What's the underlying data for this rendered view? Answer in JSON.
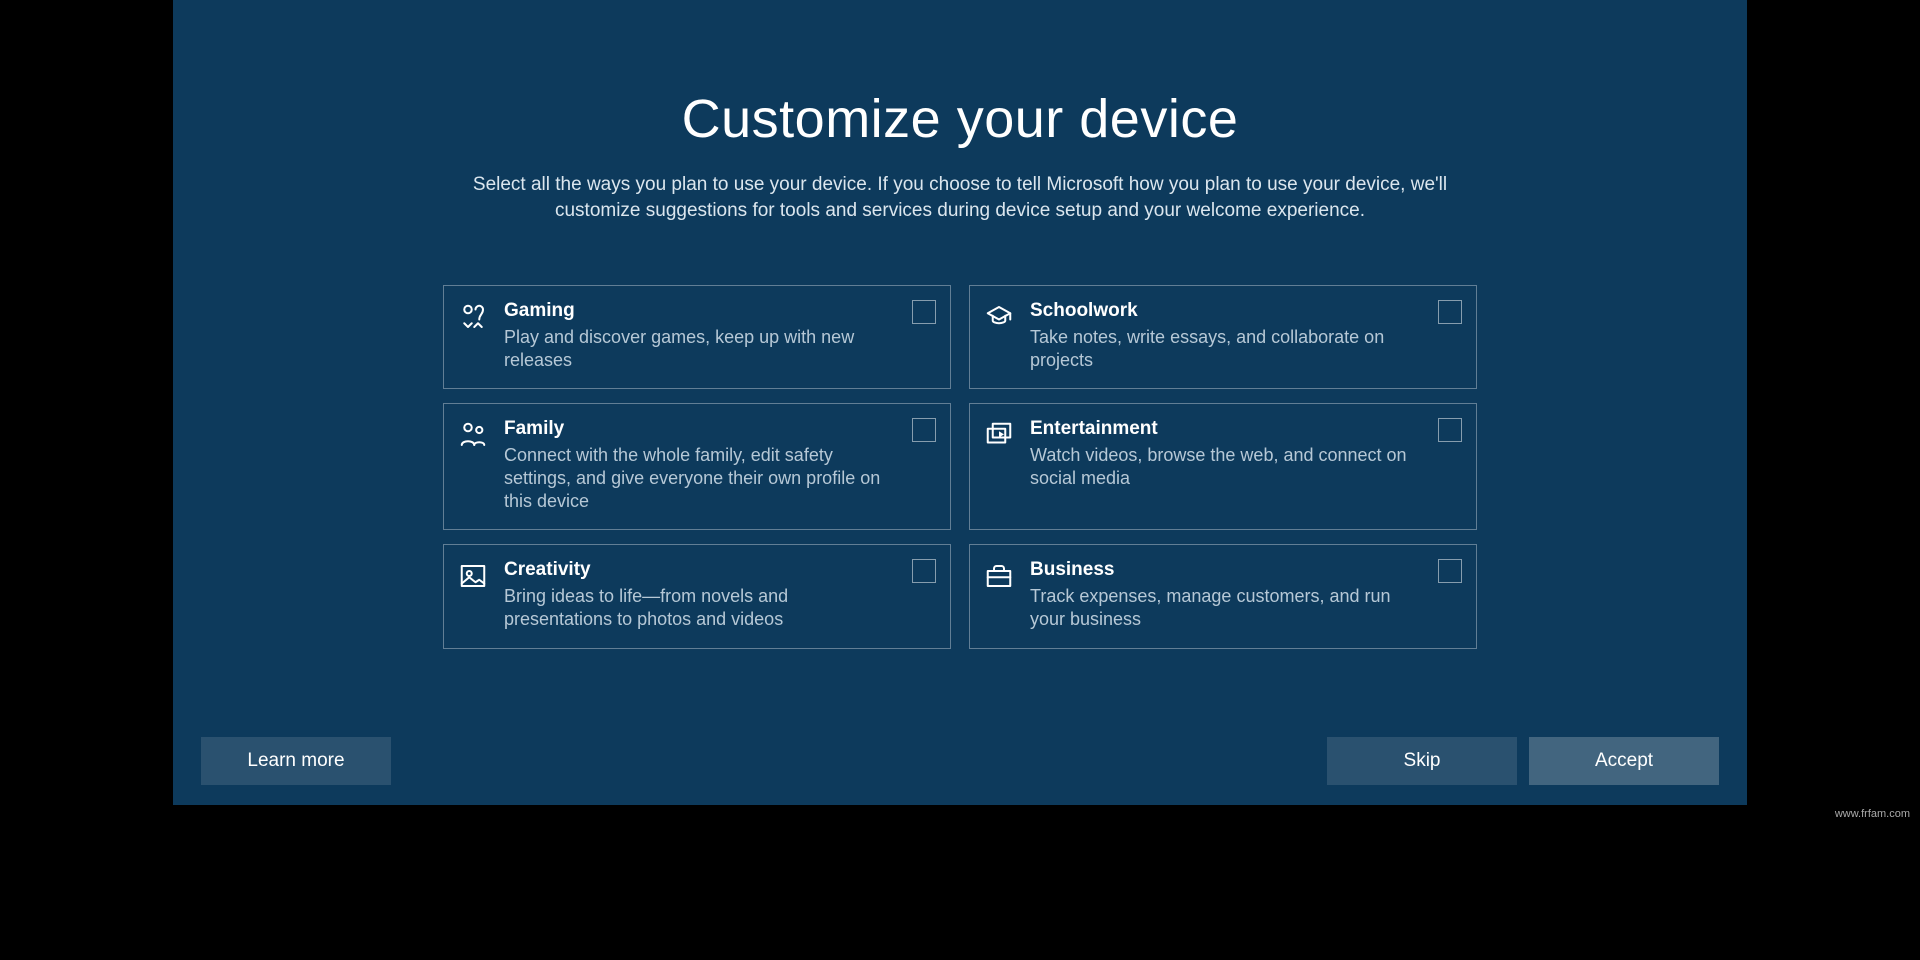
{
  "title": "Customize your device",
  "subtitle": "Select all the ways you plan to use your device. If you choose to tell Microsoft how you plan to use your device, we'll customize suggestions for tools and services during device setup and your welcome experience.",
  "cards": [
    {
      "icon": "gaming-icon",
      "title": "Gaming",
      "desc": "Play and discover games, keep up with new releases"
    },
    {
      "icon": "schoolwork-icon",
      "title": "Schoolwork",
      "desc": "Take notes, write essays, and collaborate on projects"
    },
    {
      "icon": "family-icon",
      "title": "Family",
      "desc": "Connect with the whole family, edit safety settings, and give everyone their own profile on this device"
    },
    {
      "icon": "entertainment-icon",
      "title": "Entertainment",
      "desc": "Watch videos, browse the web, and connect on social media"
    },
    {
      "icon": "creativity-icon",
      "title": "Creativity",
      "desc": "Bring ideas to life—from novels and presentations to photos and videos"
    },
    {
      "icon": "business-icon",
      "title": "Business",
      "desc": "Track expenses, manage customers, and run your business"
    }
  ],
  "footer": {
    "learn_more": "Learn more",
    "skip": "Skip",
    "accept": "Accept"
  },
  "watermark": "www.frfam.com"
}
